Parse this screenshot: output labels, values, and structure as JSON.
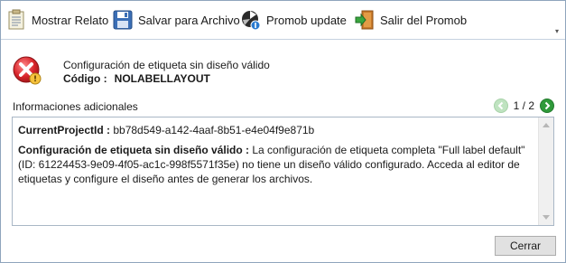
{
  "toolbar": {
    "buttons": [
      {
        "label": "Mostrar Relato",
        "icon": "report-icon"
      },
      {
        "label": "Salvar para Archivo",
        "icon": "save-icon"
      },
      {
        "label": "Promob update",
        "icon": "update-icon"
      },
      {
        "label": "Salir del Promob",
        "icon": "exit-icon"
      }
    ]
  },
  "message": {
    "title": "Configuración de etiqueta sin diseño válido",
    "code_label": "Código :",
    "code_value": "NOLABELLAYOUT"
  },
  "info": {
    "label": "Informaciones adicionales",
    "page": "1 / 2"
  },
  "details": {
    "project_key": "CurrentProjectId :",
    "project_value": "bb78d549-a142-4aaf-8b51-e4e04f9e871b",
    "error_key": "Configuración de etiqueta sin diseño válido :",
    "error_value": "La configuración de etiqueta completa \"Full label default\" (ID: 61224453-9e09-4f05-ac1c-998f5571f35e) no tiene un diseño válido configurado. Acceda al editor de etiquetas y configure el diseño antes de generar los archivos."
  },
  "buttons": {
    "close": "Cerrar"
  },
  "colors": {
    "error_red": "#d9262c",
    "nav_green": "#2f9a3a",
    "nav_green_disabled": "#bfe3c0"
  }
}
